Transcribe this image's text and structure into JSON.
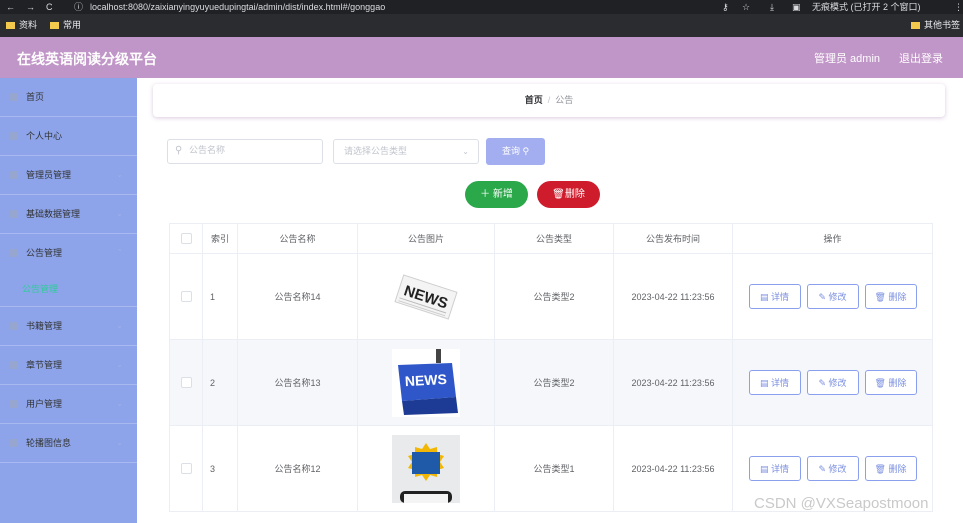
{
  "browser": {
    "url": "localhost:8080/zaixianyingyuyuedupingtai/admin/dist/index.html#/gonggao",
    "incognito_label": "无痕模式 (已打开 2 个窗口)",
    "bookmarks": [
      "资料",
      "常用"
    ],
    "other_bookmarks": "其他书签"
  },
  "header": {
    "title": "在线英语阅读分级平台",
    "admin_label": "管理员 admin",
    "logout_label": "退出登录",
    "color": "#c095c7"
  },
  "sidebar": {
    "items": [
      {
        "label": "首页",
        "icon": "home-icon"
      },
      {
        "label": "个人中心",
        "icon": "user-icon"
      },
      {
        "label": "管理员管理",
        "icon": "admin-icon"
      },
      {
        "label": "基础数据管理",
        "icon": "data-icon"
      },
      {
        "label": "公告管理",
        "icon": "notice-icon"
      },
      {
        "label": "书籍管理",
        "icon": "book-icon"
      },
      {
        "label": "章节管理",
        "icon": "chapter-icon"
      },
      {
        "label": "用户管理",
        "icon": "users-icon"
      },
      {
        "label": "轮播图信息",
        "icon": "carousel-icon"
      }
    ],
    "active_sub": "公告管理",
    "color": "#8da4ea"
  },
  "breadcrumb": {
    "home": "首页",
    "current": "公告"
  },
  "search": {
    "name_placeholder": "公告名称",
    "type_placeholder": "请选择公告类型",
    "query_label": "查询"
  },
  "actions": {
    "add_label": "新增",
    "delete_label": "删除"
  },
  "table": {
    "headers": [
      "索引",
      "公告名称",
      "公告图片",
      "公告类型",
      "公告发布时间",
      "操作"
    ],
    "rows": [
      {
        "index": "1",
        "name": "公告名称14",
        "type": "公告类型2",
        "time": "2023-04-22 11:23:56"
      },
      {
        "index": "2",
        "name": "公告名称13",
        "type": "公告类型2",
        "time": "2023-04-22 11:23:56"
      },
      {
        "index": "3",
        "name": "公告名称12",
        "type": "公告类型1",
        "time": "2023-04-22 11:23:56"
      }
    ],
    "row_actions": {
      "detail": "详情",
      "edit": "修改",
      "delete": "删除"
    }
  },
  "watermark": "CSDN @VXSeapostmoon"
}
